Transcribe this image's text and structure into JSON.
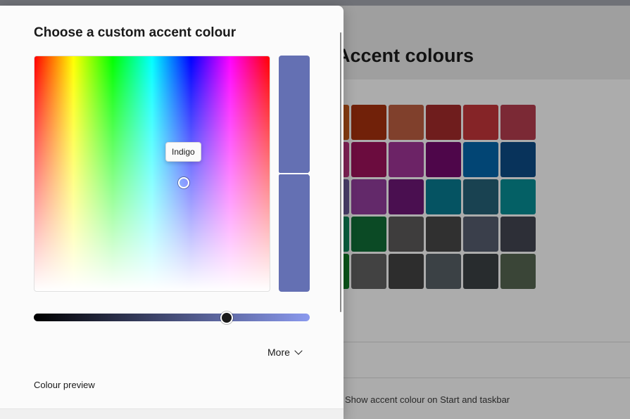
{
  "background": {
    "title": "Accent colours",
    "taskbar_label": "Show accent colour on Start and taskbar",
    "swatches": [
      "#c0561a",
      "#a3300d",
      "#b85c40",
      "#a02a2a",
      "#bf3438",
      "#b13b4d",
      "#b8327b",
      "#9a125a",
      "#9b3393",
      "#700a6b",
      "#0363a6",
      "#0c4a83",
      "#6b5a99",
      "#8e3b99",
      "#6a1673",
      "#08778d",
      "#245f74",
      "#078a91",
      "#0e8a5b",
      "#116a35",
      "#5a5858",
      "#464646",
      "#545b6c",
      "#41444f",
      "#0f7a24",
      "#5f5f5f",
      "#414141",
      "#555e63",
      "#3a3f42",
      "#536350"
    ]
  },
  "dialog": {
    "title": "Choose a custom accent colour",
    "tooltip": "Indigo",
    "selected_color": "#6470b3",
    "more_label": "More",
    "colour_preview_label": "Colour preview",
    "value_slider": {
      "from": "#000000",
      "to": "#8a99ee",
      "position_fraction": 0.7
    }
  }
}
